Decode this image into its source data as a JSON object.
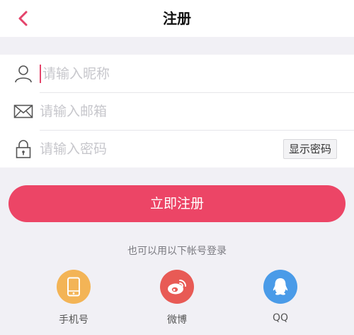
{
  "header": {
    "title": "注册"
  },
  "form": {
    "nickname_placeholder": "请输入昵称",
    "email_placeholder": "请输入邮箱",
    "password_placeholder": "请输入密码",
    "show_password_label": "显示密码"
  },
  "register_button_label": "立即注册",
  "alt_login": {
    "title": "也可以用以下帐号登录",
    "options": [
      {
        "label": "手机号",
        "icon": "phone-icon",
        "color": "#f3b456"
      },
      {
        "label": "微博",
        "icon": "weibo-icon",
        "color": "#e85a55"
      },
      {
        "label": "QQ",
        "icon": "qq-icon",
        "color": "#4a9be8"
      }
    ]
  },
  "colors": {
    "accent": "#ec4566",
    "background": "#f1f0f5"
  }
}
